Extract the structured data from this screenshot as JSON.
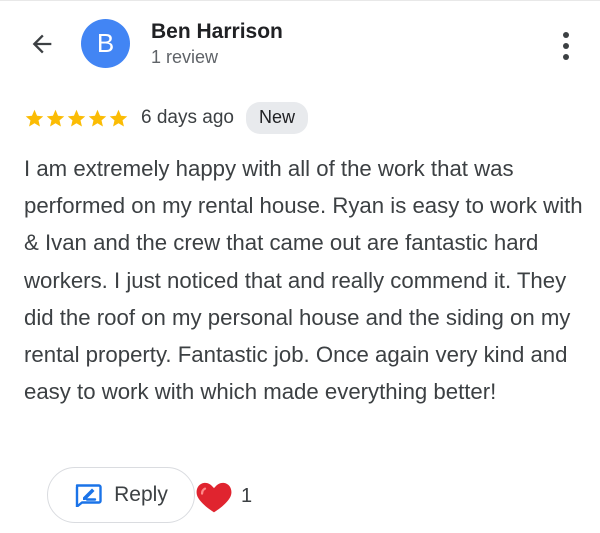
{
  "header": {
    "back_icon": "arrow-left-icon",
    "avatar_letter": "B",
    "avatar_color": "#4285f4",
    "reviewer_name": "Ben Harrison",
    "review_count": "1 review",
    "more_icon": "more-vertical-icon"
  },
  "review": {
    "rating": 5,
    "rating_max": 5,
    "star_color": "#fbbc04",
    "time_ago": "6 days ago",
    "badge": "New",
    "text": "I am extremely happy with all of the work that was performed on my rental house. Ryan is easy to work with & Ivan and the crew that came out are fantastic hard workers. I just noticed that and really commend it. They did the roof on my personal house and the siding on my rental property. Fantastic job. Once again very kind and easy to work with which made everything better!"
  },
  "actions": {
    "reply_icon": "reply-edit-icon",
    "reply_label": "Reply",
    "reply_icon_color": "#1a73e8",
    "reaction_icon": "heart-icon",
    "reaction_color": "#e0242f",
    "reaction_count": "1"
  }
}
